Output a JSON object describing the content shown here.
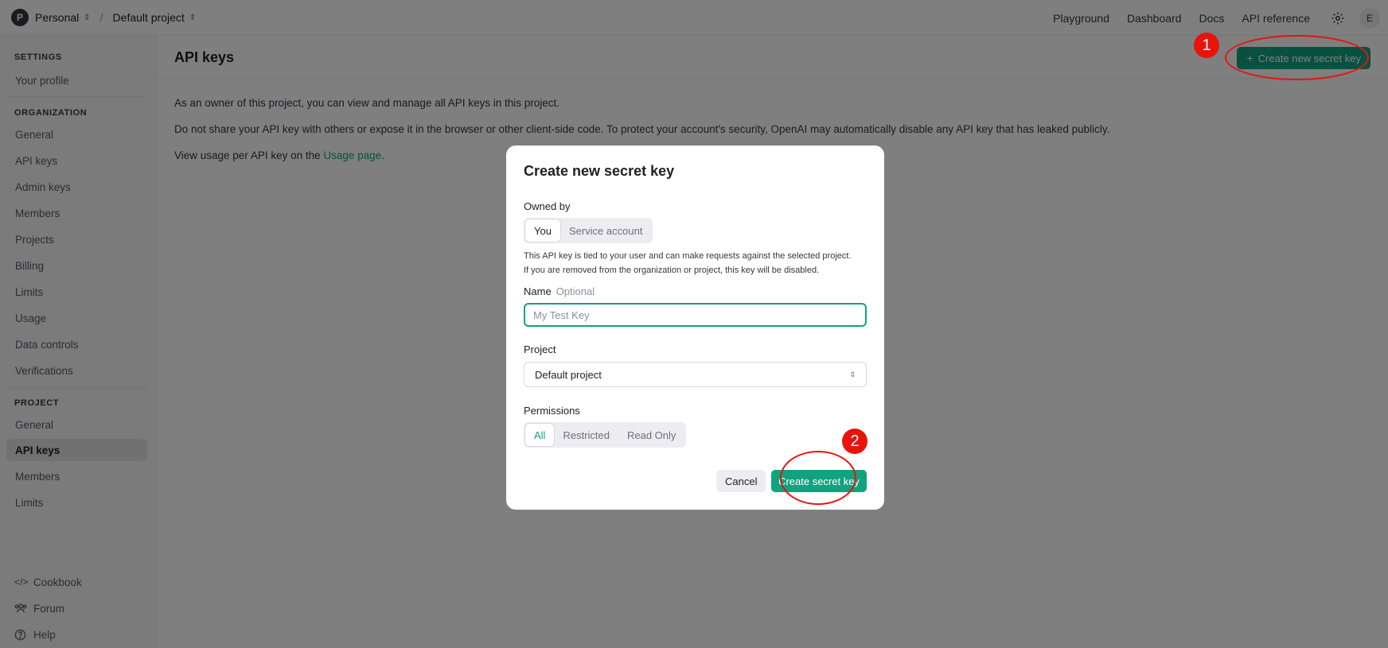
{
  "topbar": {
    "org_initial": "P",
    "org_name": "Personal",
    "project_name": "Default project",
    "nav": [
      "Playground",
      "Dashboard",
      "Docs",
      "API reference"
    ],
    "user_initial": "E"
  },
  "sidebar": {
    "settings_heading": "SETTINGS",
    "settings_items": [
      "Your profile"
    ],
    "organization_heading": "ORGANIZATION",
    "organization_items": [
      "General",
      "API keys",
      "Admin keys",
      "Members",
      "Projects",
      "Billing",
      "Limits",
      "Usage",
      "Data controls",
      "Verifications"
    ],
    "project_heading": "PROJECT",
    "project_items": [
      "General",
      "API keys",
      "Members",
      "Limits"
    ],
    "active_item": "API keys",
    "footer_items": [
      "Cookbook",
      "Forum",
      "Help"
    ]
  },
  "main": {
    "title": "API keys",
    "create_button": "Create new secret key",
    "para1": "As an owner of this project, you can view and manage all API keys in this project.",
    "para2": "Do not share your API key with others or expose it in the browser or other client-side code. To protect your account's security, OpenAI may automatically disable any API key that has leaked publicly.",
    "para3_prefix": "View usage per API key on the ",
    "para3_link": "Usage page",
    "para3_suffix": "."
  },
  "modal": {
    "title": "Create new secret key",
    "owned_by_label": "Owned by",
    "owned_by_options": [
      "You",
      "Service account"
    ],
    "owned_by_selected": "You",
    "help_text": "This API key is tied to your user and can make requests against the selected project. If you are removed from the organization or project, this key will be disabled.",
    "name_label": "Name",
    "name_optional": "Optional",
    "name_placeholder": "My Test Key",
    "name_value": "",
    "project_label": "Project",
    "project_value": "Default project",
    "permissions_label": "Permissions",
    "permissions_options": [
      "All",
      "Restricted",
      "Read Only"
    ],
    "permissions_selected": "All",
    "cancel_label": "Cancel",
    "create_label": "Create secret key"
  },
  "annotations": {
    "step1": "1",
    "step2": "2",
    "color": "#e8140c"
  },
  "colors": {
    "accent": "#10a37f"
  }
}
